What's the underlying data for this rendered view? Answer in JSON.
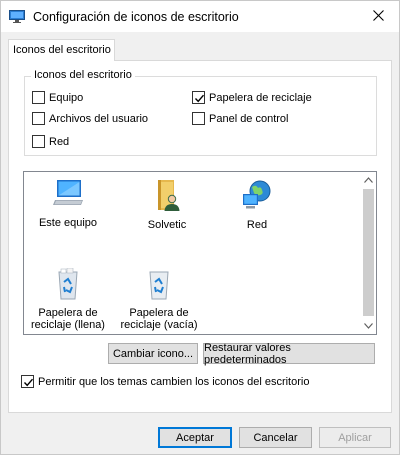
{
  "window": {
    "title": "Configuración de iconos de escritorio",
    "icon": "desktop-settings-icon"
  },
  "tabs": [
    {
      "label": "Iconos del escritorio",
      "active": true
    }
  ],
  "group": {
    "legend": "Iconos del escritorio",
    "checkboxes": [
      {
        "label": "Equipo",
        "checked": false
      },
      {
        "label": "Papelera de reciclaje",
        "checked": true
      },
      {
        "label": "Archivos del usuario",
        "checked": false
      },
      {
        "label": "Panel de control",
        "checked": false
      },
      {
        "label": "Red",
        "checked": false
      }
    ]
  },
  "icon_list": {
    "items": [
      {
        "label": "Este equipo",
        "icon": "computer-icon"
      },
      {
        "label": "Solvetic",
        "icon": "user-folder-icon"
      },
      {
        "label": "Red",
        "icon": "network-icon"
      },
      {
        "label": "Papelera de reciclaje (llena)",
        "icon": "recycle-bin-full-icon"
      },
      {
        "label": "Papelera de reciclaje (vacía)",
        "icon": "recycle-bin-empty-icon"
      }
    ]
  },
  "buttons": {
    "change_icon": "Cambiar icono...",
    "restore_defaults": "Restaurar valores predeterminados",
    "ok": "Aceptar",
    "cancel": "Cancelar",
    "apply": "Aplicar"
  },
  "allow_themes": {
    "label": "Permitir que los temas cambien los iconos del escritorio",
    "checked": true
  },
  "colors": {
    "accent": "#0078d7",
    "window_bg": "#f0f0f0"
  }
}
